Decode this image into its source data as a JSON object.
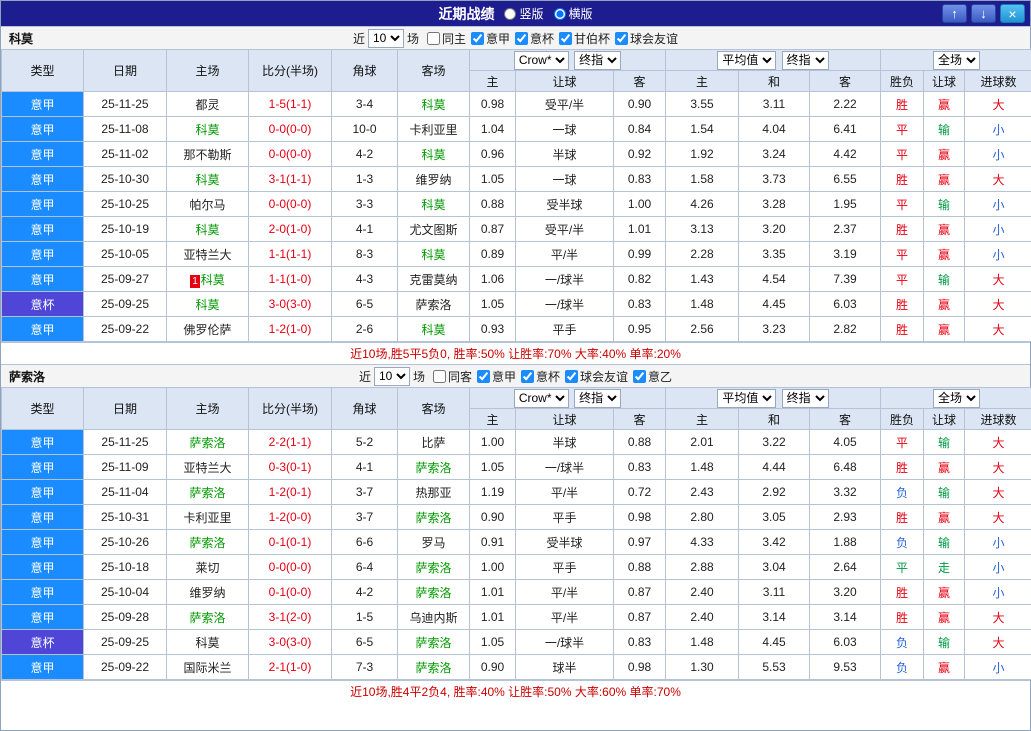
{
  "colors": {
    "titlebar_bg": "#1d1d8f",
    "header_bg": "#dbe5f3",
    "league_colors": {
      "意甲": "#1a8cff",
      "意杯": "#4f46d8"
    },
    "win_red": "#e60012",
    "lose_green": "#009944",
    "draw_blue": "#2862d8",
    "team_green": "#009900",
    "summary_red": "#cc0000"
  },
  "titlebar": {
    "title": "近期战绩",
    "radio_options": [
      {
        "label": "竖版",
        "selected": false
      },
      {
        "label": "横版",
        "selected": true
      }
    ],
    "buttons": {
      "up": "↑",
      "down": "↓",
      "close": "×"
    }
  },
  "ui": {
    "near_label": "近",
    "games_label": "场"
  },
  "table_head": {
    "type": "类型",
    "date": "日期",
    "home": "主场",
    "score": "比分(半场)",
    "corner": "角球",
    "away": "客场",
    "asia_home": "主",
    "asia_handicap": "让球",
    "asia_away": "客",
    "euro_home": "主",
    "euro_draw": "和",
    "euro_away": "客",
    "result": "胜负",
    "let_result": "让球",
    "goals": "进球数"
  },
  "tables": [
    {
      "team": "科莫",
      "filter": {
        "count": "10",
        "checkboxes": [
          {
            "label": "同主",
            "checked": false
          },
          {
            "label": "意甲",
            "checked": true
          },
          {
            "label": "意杯",
            "checked": true
          },
          {
            "label": "甘伯杯",
            "checked": true
          },
          {
            "label": "球会友谊",
            "checked": true
          }
        ]
      },
      "selects": {
        "bookmaker": "Crow*",
        "asia_index": "终指",
        "euro_avg": "平均值",
        "euro_index": "终指",
        "scope": "全场"
      },
      "rows": [
        {
          "league": "意甲",
          "date": "25-11-25",
          "home": "都灵",
          "home_green": false,
          "score": "1-5(1-1)",
          "corner": "3-4",
          "away": "科莫",
          "away_green": true,
          "ah": "0.98",
          "hc": "受平/半",
          "aa": "0.90",
          "eh": "3.55",
          "ed": "3.11",
          "ea": "2.22",
          "res": "胜",
          "res_c": "red",
          "lr": "赢",
          "lr_c": "red",
          "gl": "大",
          "gl_c": "red"
        },
        {
          "league": "意甲",
          "date": "25-11-08",
          "home": "科莫",
          "home_green": true,
          "score": "0-0(0-0)",
          "corner": "10-0",
          "away": "卡利亚里",
          "away_green": false,
          "ah": "1.04",
          "hc": "一球",
          "aa": "0.84",
          "eh": "1.54",
          "ed": "4.04",
          "ea": "6.41",
          "res": "平",
          "res_c": "red",
          "lr": "输",
          "lr_c": "green",
          "gl": "小",
          "gl_c": "blue"
        },
        {
          "league": "意甲",
          "date": "25-11-02",
          "home": "那不勒斯",
          "home_green": false,
          "score": "0-0(0-0)",
          "corner": "4-2",
          "away": "科莫",
          "away_green": true,
          "ah": "0.96",
          "hc": "半球",
          "aa": "0.92",
          "eh": "1.92",
          "ed": "3.24",
          "ea": "4.42",
          "res": "平",
          "res_c": "red",
          "lr": "赢",
          "lr_c": "red",
          "gl": "小",
          "gl_c": "blue"
        },
        {
          "league": "意甲",
          "date": "25-10-30",
          "home": "科莫",
          "home_green": true,
          "score": "3-1(1-1)",
          "corner": "1-3",
          "away": "维罗纳",
          "away_green": false,
          "ah": "1.05",
          "hc": "一球",
          "aa": "0.83",
          "eh": "1.58",
          "ed": "3.73",
          "ea": "6.55",
          "res": "胜",
          "res_c": "red",
          "lr": "赢",
          "lr_c": "red",
          "gl": "大",
          "gl_c": "red"
        },
        {
          "league": "意甲",
          "date": "25-10-25",
          "home": "帕尔马",
          "home_green": false,
          "score": "0-0(0-0)",
          "corner": "3-3",
          "away": "科莫",
          "away_green": true,
          "ah": "0.88",
          "hc": "受半球",
          "aa": "1.00",
          "eh": "4.26",
          "ed": "3.28",
          "ea": "1.95",
          "res": "平",
          "res_c": "red",
          "lr": "输",
          "lr_c": "green",
          "gl": "小",
          "gl_c": "blue"
        },
        {
          "league": "意甲",
          "date": "25-10-19",
          "home": "科莫",
          "home_green": true,
          "score": "2-0(1-0)",
          "corner": "4-1",
          "away": "尤文图斯",
          "away_green": false,
          "ah": "0.87",
          "hc": "受平/半",
          "aa": "1.01",
          "eh": "3.13",
          "ed": "3.20",
          "ea": "2.37",
          "res": "胜",
          "res_c": "red",
          "lr": "赢",
          "lr_c": "red",
          "gl": "小",
          "gl_c": "blue"
        },
        {
          "league": "意甲",
          "date": "25-10-05",
          "home": "亚特兰大",
          "home_green": false,
          "score": "1-1(1-1)",
          "corner": "8-3",
          "away": "科莫",
          "away_green": true,
          "ah": "0.89",
          "hc": "平/半",
          "aa": "0.99",
          "eh": "2.28",
          "ed": "3.35",
          "ea": "3.19",
          "res": "平",
          "res_c": "red",
          "lr": "赢",
          "lr_c": "red",
          "gl": "小",
          "gl_c": "blue"
        },
        {
          "league": "意甲",
          "date": "25-09-27",
          "home": "科莫",
          "home_green": true,
          "home_badge": "1",
          "score": "1-1(1-0)",
          "corner": "4-3",
          "away": "克雷莫纳",
          "away_green": false,
          "ah": "1.06",
          "hc": "一/球半",
          "aa": "0.82",
          "eh": "1.43",
          "ed": "4.54",
          "ea": "7.39",
          "res": "平",
          "res_c": "red",
          "lr": "输",
          "lr_c": "green",
          "gl": "大",
          "gl_c": "red"
        },
        {
          "league": "意杯",
          "date": "25-09-25",
          "home": "科莫",
          "home_green": true,
          "score": "3-0(3-0)",
          "corner": "6-5",
          "away": "萨索洛",
          "away_green": false,
          "ah": "1.05",
          "hc": "一/球半",
          "aa": "0.83",
          "eh": "1.48",
          "ed": "4.45",
          "ea": "6.03",
          "res": "胜",
          "res_c": "red",
          "lr": "赢",
          "lr_c": "red",
          "gl": "大",
          "gl_c": "red"
        },
        {
          "league": "意甲",
          "date": "25-09-22",
          "home": "佛罗伦萨",
          "home_green": false,
          "score": "1-2(1-0)",
          "corner": "2-6",
          "away": "科莫",
          "away_green": true,
          "ah": "0.93",
          "hc": "平手",
          "aa": "0.95",
          "eh": "2.56",
          "ed": "3.23",
          "ea": "2.82",
          "res": "胜",
          "res_c": "red",
          "lr": "赢",
          "lr_c": "red",
          "gl": "大",
          "gl_c": "red"
        }
      ],
      "summary": "近10场,胜5平5负0, 胜率:50% 让胜率:70% 大率:40% 单率:20%"
    },
    {
      "team": "萨索洛",
      "filter": {
        "count": "10",
        "checkboxes": [
          {
            "label": "同客",
            "checked": false
          },
          {
            "label": "意甲",
            "checked": true
          },
          {
            "label": "意杯",
            "checked": true
          },
          {
            "label": "球会友谊",
            "checked": true
          },
          {
            "label": "意乙",
            "checked": true
          }
        ]
      },
      "selects": {
        "bookmaker": "Crow*",
        "asia_index": "终指",
        "euro_avg": "平均值",
        "euro_index": "终指",
        "scope": "全场"
      },
      "rows": [
        {
          "league": "意甲",
          "date": "25-11-25",
          "home": "萨索洛",
          "home_green": true,
          "score": "2-2(1-1)",
          "corner": "5-2",
          "away": "比萨",
          "away_green": false,
          "ah": "1.00",
          "hc": "半球",
          "aa": "0.88",
          "eh": "2.01",
          "ed": "3.22",
          "ea": "4.05",
          "res": "平",
          "res_c": "red",
          "lr": "输",
          "lr_c": "green",
          "gl": "大",
          "gl_c": "red"
        },
        {
          "league": "意甲",
          "date": "25-11-09",
          "home": "亚特兰大",
          "home_green": false,
          "score": "0-3(0-1)",
          "corner": "4-1",
          "away": "萨索洛",
          "away_green": true,
          "ah": "1.05",
          "hc": "一/球半",
          "aa": "0.83",
          "eh": "1.48",
          "ed": "4.44",
          "ea": "6.48",
          "res": "胜",
          "res_c": "red",
          "lr": "赢",
          "lr_c": "red",
          "gl": "大",
          "gl_c": "red"
        },
        {
          "league": "意甲",
          "date": "25-11-04",
          "home": "萨索洛",
          "home_green": true,
          "score": "1-2(0-1)",
          "corner": "3-7",
          "away": "热那亚",
          "away_green": false,
          "ah": "1.19",
          "hc": "平/半",
          "aa": "0.72",
          "eh": "2.43",
          "ed": "2.92",
          "ea": "3.32",
          "res": "负",
          "res_c": "blue",
          "lr": "输",
          "lr_c": "green",
          "gl": "大",
          "gl_c": "red"
        },
        {
          "league": "意甲",
          "date": "25-10-31",
          "home": "卡利亚里",
          "home_green": false,
          "score": "1-2(0-0)",
          "corner": "3-7",
          "away": "萨索洛",
          "away_green": true,
          "ah": "0.90",
          "hc": "平手",
          "aa": "0.98",
          "eh": "2.80",
          "ed": "3.05",
          "ea": "2.93",
          "res": "胜",
          "res_c": "red",
          "lr": "赢",
          "lr_c": "red",
          "gl": "大",
          "gl_c": "red"
        },
        {
          "league": "意甲",
          "date": "25-10-26",
          "home": "萨索洛",
          "home_green": true,
          "score": "0-1(0-1)",
          "corner": "6-6",
          "away": "罗马",
          "away_green": false,
          "ah": "0.91",
          "hc": "受半球",
          "aa": "0.97",
          "eh": "4.33",
          "ed": "3.42",
          "ea": "1.88",
          "res": "负",
          "res_c": "blue",
          "lr": "输",
          "lr_c": "green",
          "gl": "小",
          "gl_c": "blue"
        },
        {
          "league": "意甲",
          "date": "25-10-18",
          "home": "莱切",
          "home_green": false,
          "score": "0-0(0-0)",
          "corner": "6-4",
          "away": "萨索洛",
          "away_green": true,
          "ah": "1.00",
          "hc": "平手",
          "aa": "0.88",
          "eh": "2.88",
          "ed": "3.04",
          "ea": "2.64",
          "res": "平",
          "res_c": "green",
          "lr": "走",
          "lr_c": "green",
          "gl": "小",
          "gl_c": "blue"
        },
        {
          "league": "意甲",
          "date": "25-10-04",
          "home": "维罗纳",
          "home_green": false,
          "score": "0-1(0-0)",
          "corner": "4-2",
          "away": "萨索洛",
          "away_green": true,
          "ah": "1.01",
          "hc": "平/半",
          "aa": "0.87",
          "eh": "2.40",
          "ed": "3.11",
          "ea": "3.20",
          "res": "胜",
          "res_c": "red",
          "lr": "赢",
          "lr_c": "red",
          "gl": "小",
          "gl_c": "blue"
        },
        {
          "league": "意甲",
          "date": "25-09-28",
          "home": "萨索洛",
          "home_green": true,
          "score": "3-1(2-0)",
          "corner": "1-5",
          "away": "乌迪内斯",
          "away_green": false,
          "ah": "1.01",
          "hc": "平/半",
          "aa": "0.87",
          "eh": "2.40",
          "ed": "3.14",
          "ea": "3.14",
          "res": "胜",
          "res_c": "red",
          "lr": "赢",
          "lr_c": "red",
          "gl": "大",
          "gl_c": "red"
        },
        {
          "league": "意杯",
          "date": "25-09-25",
          "home": "科莫",
          "home_green": false,
          "score": "3-0(3-0)",
          "corner": "6-5",
          "away": "萨索洛",
          "away_green": true,
          "ah": "1.05",
          "hc": "一/球半",
          "aa": "0.83",
          "eh": "1.48",
          "ed": "4.45",
          "ea": "6.03",
          "res": "负",
          "res_c": "blue",
          "lr": "输",
          "lr_c": "green",
          "gl": "大",
          "gl_c": "red"
        },
        {
          "league": "意甲",
          "date": "25-09-22",
          "home": "国际米兰",
          "home_green": false,
          "score": "2-1(1-0)",
          "corner": "7-3",
          "away": "萨索洛",
          "away_green": true,
          "ah": "0.90",
          "hc": "球半",
          "aa": "0.98",
          "eh": "1.30",
          "ed": "5.53",
          "ea": "9.53",
          "res": "负",
          "res_c": "blue",
          "lr": "赢",
          "lr_c": "red",
          "gl": "小",
          "gl_c": "blue"
        }
      ],
      "summary": "近10场,胜4平2负4, 胜率:40% 让胜率:50% 大率:60% 单率:70%"
    }
  ]
}
